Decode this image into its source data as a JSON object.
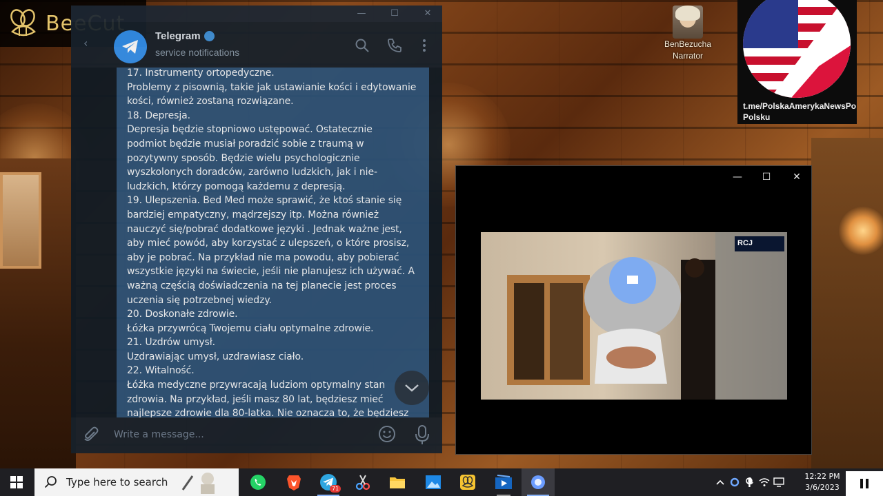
{
  "watermark": {
    "brand": "BeeCut"
  },
  "telegram": {
    "window_title": "Telegram",
    "chat_name": "Telegram",
    "chat_status": "service notifications",
    "message_lines": [
      "17. Instrumenty ortopedyczne.",
      "Problemy z pisownią, takie jak ustawianie kości i edytowanie",
      "kości, również zostaną rozwiązane.",
      "18. Depresja.",
      "Depresja będzie stopniowo ustępować. Ostatecznie",
      "podmiot będzie musiał poradzić sobie z traumą w",
      "pozytywny sposób. Będzie wielu psychologicznie",
      "wyszkolonych doradców, zarówno ludzkich, jak i nie-",
      "ludzkich, którzy pomogą każdemu z depresją.",
      "19. Ulepszenia. Bed Med może sprawić, że ktoś stanie się",
      "bardziej empatyczny, mądrzejszy itp. Można również",
      "nauczyć się/pobrać dodatkowe języki . Jednak ważne jest,",
      "aby mieć powód, aby korzystać z ulepszeń, o które prosisz,",
      "aby je pobrać. Na przykład nie ma powodu, aby pobierać",
      "wszystkie języki na świecie, jeśli nie planujesz ich używać. A",
      "ważną częścią doświadczenia na tej planecie jest proces",
      "uczenia się potrzebnej wiedzy.",
      "20. Doskonałe zdrowie.",
      "Łóżka przywrócą Twojemu ciału optymalne zdrowie.",
      "21. Uzdrów umysł.",
      "Uzdrawiając umysł, uzdrawiasz ciało.",
      "22. Witalność.",
      "Łóżka medyczne przywracają ludziom optymalny stan",
      "zdrowia. Na przykład, jeśli masz 80 lat, będziesz mieć",
      "najlepsze zdrowie dla 80-latka. Nie oznacza to, że będziesz"
    ],
    "compose_placeholder": "Write a message..."
  },
  "narrator": {
    "name": "BenBezucha",
    "role": "Narrator"
  },
  "channel_card": {
    "link_text": "t.me/PolskaAmerykaNewsPo Polsku"
  },
  "video": {
    "logo_text": "RCJ"
  },
  "taskbar": {
    "search_placeholder": "Type here to search",
    "time": "12:22 PM",
    "date": "3/6/2023",
    "telegram_badge": "71"
  },
  "colors": {
    "telegram_bubble": "#2b5278",
    "telegram_bg": "#17212b",
    "beecut_gold": "#e3c36b"
  }
}
